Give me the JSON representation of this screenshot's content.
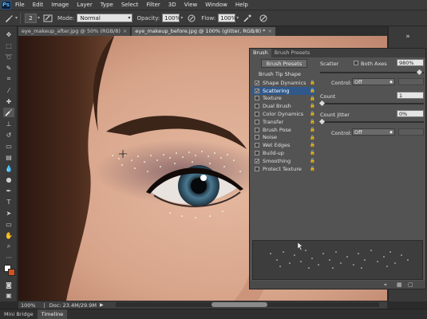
{
  "app": {
    "logo": "Ps"
  },
  "menu": [
    "File",
    "Edit",
    "Image",
    "Layer",
    "Type",
    "Select",
    "Filter",
    "3D",
    "View",
    "Window",
    "Help"
  ],
  "options": {
    "brush_size": "2",
    "mode_label": "Mode:",
    "mode_value": "Normal",
    "opacity_label": "Opacity:",
    "opacity_value": "100%",
    "flow_label": "Flow:",
    "flow_value": "100%"
  },
  "tabs": [
    {
      "label": "eye_makeup_after.jpg @ 50% (RGB/8)",
      "close": "×",
      "active": false
    },
    {
      "label": "eye_makeup_before.jpg @ 100% (glitter, RGB/8) *",
      "close": "×",
      "active": true
    }
  ],
  "brush_panel": {
    "tabs": [
      "Brush",
      "Brush Presets"
    ],
    "presets_button": "Brush Presets",
    "tip_header": "Brush Tip Shape",
    "items": [
      {
        "label": "Shape Dynamics",
        "checked": true,
        "selected": false
      },
      {
        "label": "Scattering",
        "checked": true,
        "selected": true
      },
      {
        "label": "Texture",
        "checked": false,
        "selected": false
      },
      {
        "label": "Dual Brush",
        "checked": false,
        "selected": false
      },
      {
        "label": "Color Dynamics",
        "checked": false,
        "selected": false
      },
      {
        "label": "Transfer",
        "checked": false,
        "selected": false
      },
      {
        "label": "Brush Pose",
        "checked": false,
        "selected": false
      },
      {
        "label": "Noise",
        "checked": false,
        "selected": false
      },
      {
        "label": "Wet Edges",
        "checked": false,
        "selected": false
      },
      {
        "label": "Build-up",
        "checked": false,
        "selected": false
      },
      {
        "label": "Smoothing",
        "checked": true,
        "selected": false
      },
      {
        "label": "Protect Texture",
        "checked": false,
        "selected": false
      }
    ],
    "scatter_label": "Scatter",
    "both_axes_label": "Both Axes",
    "both_axes_checked": false,
    "scatter_value": "980%",
    "scatter_fraction": 0.98,
    "control_label": "Control:",
    "control_value": "Off",
    "count_label": "Count",
    "count_value": "1",
    "count_fraction": 0.0,
    "count_jitter_label": "Count Jitter",
    "count_jitter_value": "0%",
    "count_jitter_fraction": 0.0,
    "control2_label": "Control:",
    "control2_value": "Off"
  },
  "status": {
    "zoom": "100%",
    "doc": "Doc: 23.4M/29.9M"
  },
  "bottom_tabs": [
    "Mini Bridge",
    "Timeline"
  ],
  "colors": {
    "selection": "#31588a",
    "foreground": "#ffffff",
    "background": "#d2511f"
  }
}
